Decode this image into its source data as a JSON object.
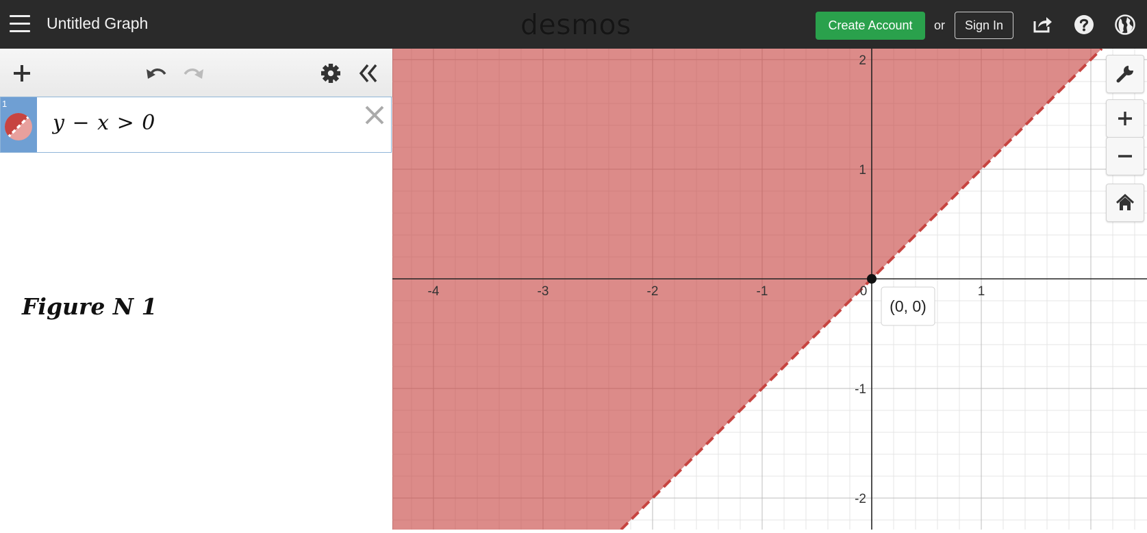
{
  "header": {
    "title": "Untitled Graph",
    "logo": "desmos",
    "create_account": "Create Account",
    "or": "or",
    "sign_in": "Sign In"
  },
  "sidebar": {
    "expression": {
      "index": "1",
      "latex_display": "y − x > 0",
      "color": "#c74440"
    },
    "caption": "Figure N 1"
  },
  "graph": {
    "point_label": "(0, 0)",
    "x_tick_labels": [
      "-4",
      "-3",
      "-2",
      "-1",
      "0",
      "1"
    ],
    "y_tick_labels": [
      "2",
      "1",
      "-1",
      "-2"
    ],
    "fill_color": "#c74440",
    "boundary": "dashed"
  },
  "icons": {
    "menu": "hamburger-icon",
    "share": "share-icon",
    "help": "help-icon",
    "language": "globe-icon",
    "add": "plus-icon",
    "undo": "undo-icon",
    "redo": "redo-icon",
    "settings": "gear-icon",
    "collapse": "double-chevron-left-icon",
    "delete": "close-icon",
    "graph_settings": "wrench-icon",
    "zoom_in": "zoom-in-icon",
    "zoom_out": "zoom-out-icon",
    "home": "home-icon"
  }
}
